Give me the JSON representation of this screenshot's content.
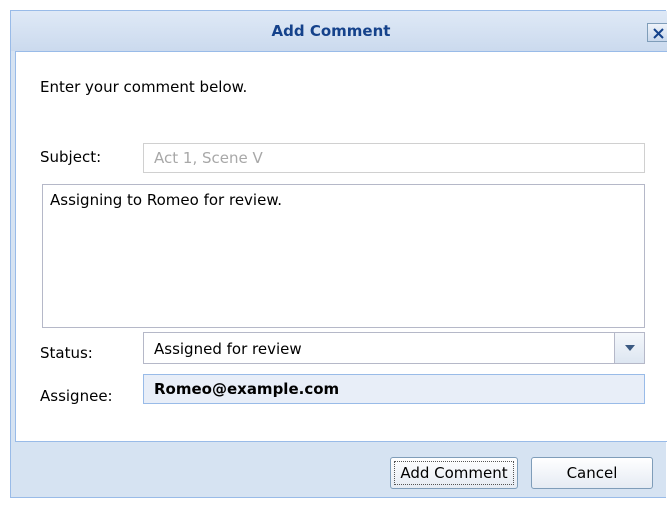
{
  "dialog": {
    "title": "Add Comment",
    "close_icon": "close-icon"
  },
  "form": {
    "intro": "Enter your comment below.",
    "subject_label": "Subject:",
    "subject_value": "Act 1, Scene V",
    "comment_text": "Assigning to Romeo for review.",
    "status_label": "Status:",
    "status_value": "Assigned for review",
    "status_arrow_icon": "chevron-down-icon",
    "assignee_label": "Assignee:",
    "assignee_value": "Romeo@example.com"
  },
  "buttons": {
    "add_label": "Add Comment",
    "cancel_label": "Cancel"
  },
  "colors": {
    "title_text": "#15428b",
    "frame": "#d6e3f2",
    "border": "#99bbe8",
    "assignee_bg": "#e8eef8"
  }
}
